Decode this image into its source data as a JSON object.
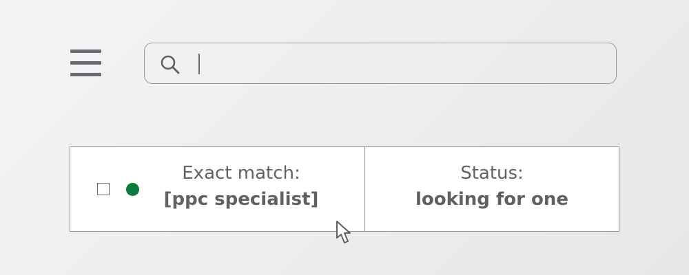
{
  "header": {
    "menu_icon": "hamburger-menu-icon",
    "search": {
      "icon": "search-icon",
      "value": "",
      "placeholder": ""
    }
  },
  "keyword_row": {
    "checkbox_checked": false,
    "status_dot_color": "#0b7a3e",
    "match_label": "Exact match:",
    "match_value": "[ppc specialist]",
    "status_label": "Status:",
    "status_value": "looking for one"
  },
  "pointer": "mouse-pointer-icon"
}
